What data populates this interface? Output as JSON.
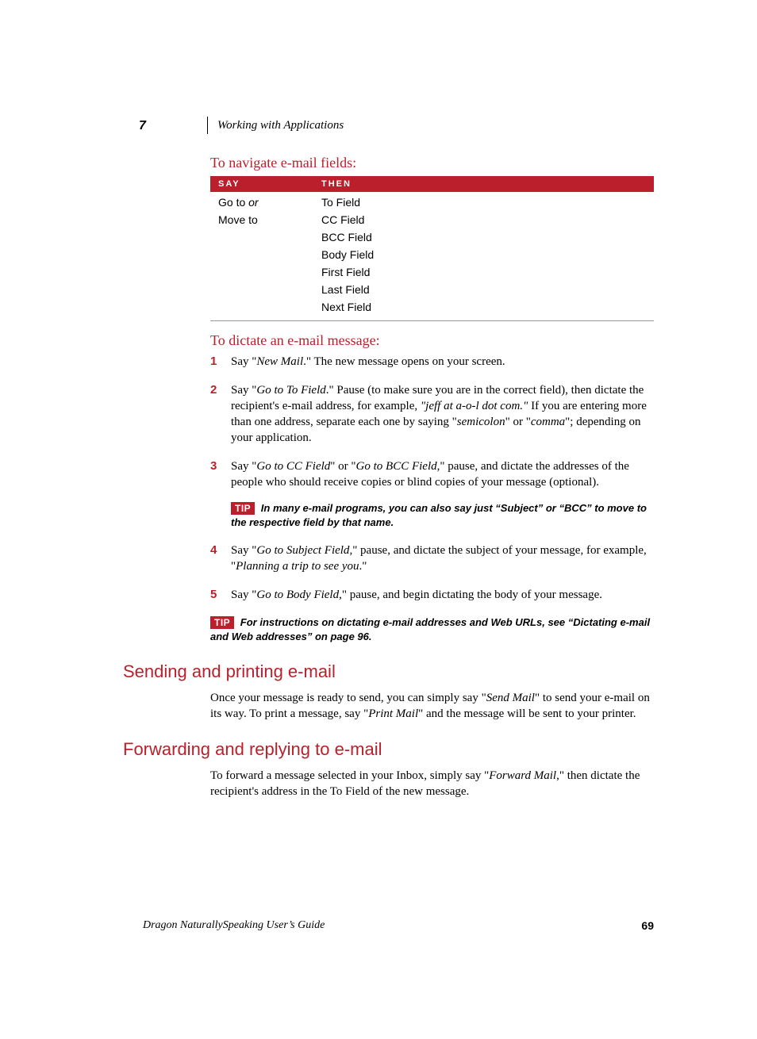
{
  "chapter": "7",
  "header": "Working with Applications",
  "sub1_title": "To navigate e-mail fields:",
  "table": {
    "col1": "SAY",
    "col2": "THEN",
    "say1": "Go to ",
    "say_or": "or",
    "say2": "Move to",
    "then": [
      "To Field",
      "CC Field",
      "BCC Field",
      "Body Field",
      "First Field",
      "Last Field",
      "Next Field"
    ]
  },
  "sub2_title": "To dictate an e-mail message:",
  "steps": [
    "Say “New Mail.” The new message opens on your screen.",
    "Say “Go to To Field.” Pause (to make sure you are in the correct field), then dictate the recipient’s e-mail address, for example, “jeff at a-o-l dot com.” If you are entering more than one address, separate each one by saying “semicolon” or “comma”; depending on your application.",
    "Say “Go to CC Field” or “Go to BCC Field,” pause, and dictate the addresses of the people who should receive copies or blind copies of your message (optional).",
    "Say “Go to Subject Field,” pause, and dictate the subject of your message, for example, “Planning a trip to see you.”",
    "Say “Go to Body Field,” pause, and begin dictating the body of your message."
  ],
  "tip1_label": "TIP",
  "tip1": "In many e-mail programs, you can also say just “Subject” or “BCC” to move to the respective field by that name.",
  "tip2_label": "TIP",
  "tip2": "For instructions on dictating e-mail addresses and Web URLs, see “Dictating e-mail and Web addresses” on page 96.",
  "section_send": "Sending and printing e-mail",
  "para_send": "Once your message is ready to send, you can simply say “Send Mail” to send your e-mail on its way. To print a message, say “Print Mail” and the message will be sent to your printer.",
  "section_fwd": "Forwarding and replying to e-mail",
  "para_fwd": "To forward a message selected in your Inbox, simply say “Forward Mail,” then dictate the recipient’s address in the To Field of the new message.",
  "footer_guide": "Dragon NaturallySpeaking User’s Guide",
  "footer_page": "69"
}
